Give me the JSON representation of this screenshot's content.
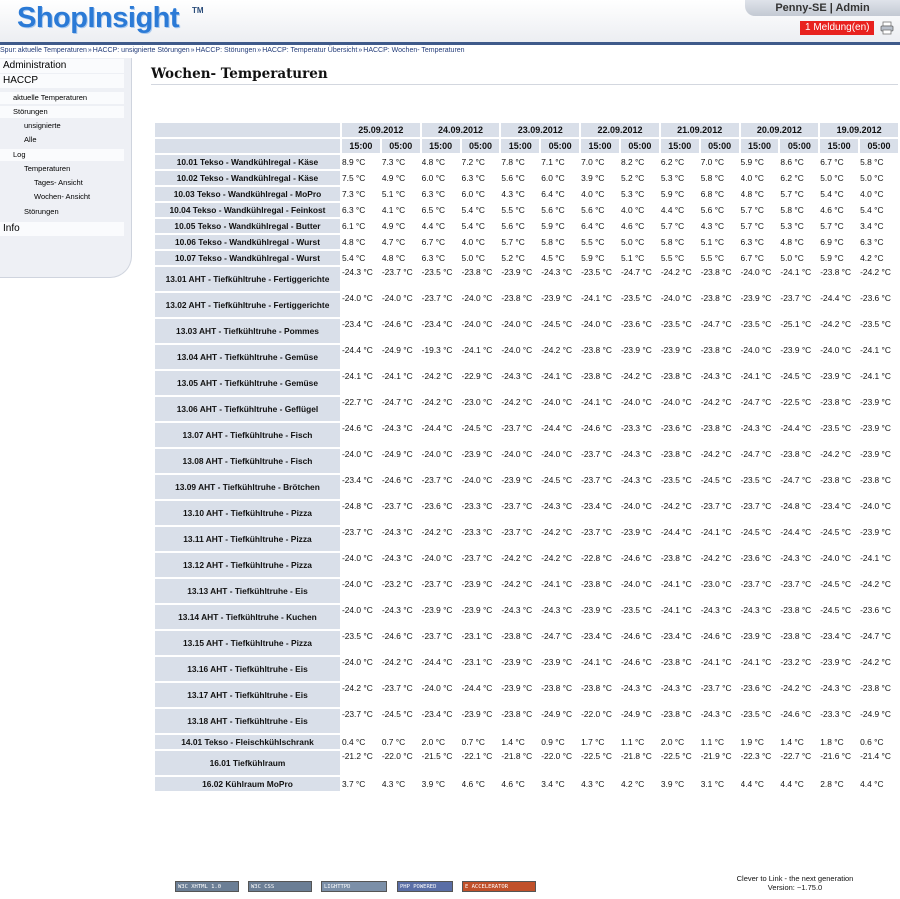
{
  "app": {
    "logo": "ShopInsight",
    "logo_tm": "TM",
    "user": "Penny-SE | Admin",
    "messages": "1 Meldung(en)",
    "print_icon": "printer-icon"
  },
  "breadcrumb": [
    "Spur:",
    "aktuelle Temperaturen",
    "»",
    "HACCP: unsignierte Störungen",
    "»",
    "HACCP: Störungen",
    "»",
    "HACCP: Temperatur Übersicht",
    "»",
    "HACCP: Wochen- Temperaturen"
  ],
  "sidebar": {
    "items": [
      {
        "label": "Administration",
        "level": 0
      },
      {
        "label": "HACCP",
        "level": 0
      },
      {
        "label": "aktuelle Temperaturen",
        "level": 1
      },
      {
        "label": "Störungen",
        "level": 1
      },
      {
        "label": "unsignierte",
        "level": 2
      },
      {
        "label": "Alle",
        "level": 2
      },
      {
        "label": "Log",
        "level": 1
      },
      {
        "label": "Temperaturen",
        "level": 2
      },
      {
        "label": "Tages- Ansicht",
        "level": 3
      },
      {
        "label": "Wochen- Ansicht",
        "level": 3
      },
      {
        "label": "Störungen",
        "level": 2
      },
      {
        "label": "Info",
        "level": 0
      }
    ]
  },
  "main": {
    "title": "Wochen- Temperaturen",
    "dates": [
      "25.09.2012",
      "24.09.2012",
      "23.09.2012",
      "22.09.2012",
      "21.09.2012",
      "20.09.2012",
      "19.09.2012"
    ],
    "times": [
      "15:00",
      "05:00",
      "15:00",
      "05:00",
      "15:00",
      "05:00",
      "15:00",
      "05:00",
      "15:00",
      "05:00",
      "15:00",
      "05:00",
      "15:00",
      "05:00"
    ],
    "rows": [
      {
        "label": "10.01 Tekso - Wandkühlregal - Käse",
        "values": [
          "8.9 °C",
          "7.3 °C",
          "4.8 °C",
          "7.2 °C",
          "7.8 °C",
          "7.1 °C",
          "7.0 °C",
          "8.2 °C",
          "6.2 °C",
          "7.0 °C",
          "5.9 °C",
          "8.6 °C",
          "6.7 °C",
          "5.8 °C"
        ]
      },
      {
        "label": "10.02 Tekso - Wandkühlregal - Käse",
        "values": [
          "7.5 °C",
          "4.9 °C",
          "6.0 °C",
          "6.3 °C",
          "5.6 °C",
          "6.0 °C",
          "3.9 °C",
          "5.2 °C",
          "5.3 °C",
          "5.8 °C",
          "4.0 °C",
          "6.2 °C",
          "5.0 °C",
          "5.0 °C"
        ]
      },
      {
        "label": "10.03 Tekso - Wandkühlregal - MoPro",
        "values": [
          "7.3 °C",
          "5.1 °C",
          "6.3 °C",
          "6.0 °C",
          "4.3 °C",
          "6.4 °C",
          "4.0 °C",
          "5.3 °C",
          "5.9 °C",
          "6.8 °C",
          "4.8 °C",
          "5.7 °C",
          "5.4 °C",
          "4.0 °C"
        ]
      },
      {
        "label": "10.04 Tekso - Wandkühlregal - Feinkost",
        "values": [
          "6.3 °C",
          "4.1 °C",
          "6.5 °C",
          "5.4 °C",
          "5.5 °C",
          "5.6 °C",
          "5.6 °C",
          "4.0 °C",
          "4.4 °C",
          "5.6 °C",
          "5.7 °C",
          "5.8 °C",
          "4.6 °C",
          "5.4 °C"
        ]
      },
      {
        "label": "10.05 Tekso - Wandkühlregal - Butter",
        "values": [
          "6.1 °C",
          "4.9 °C",
          "4.4 °C",
          "5.4 °C",
          "5.6 °C",
          "5.9 °C",
          "6.4 °C",
          "4.6 °C",
          "5.7 °C",
          "4.3 °C",
          "5.7 °C",
          "5.3 °C",
          "5.7 °C",
          "3.4 °C"
        ]
      },
      {
        "label": "10.06 Tekso - Wandkühlregal - Wurst",
        "values": [
          "4.8 °C",
          "4.7 °C",
          "6.7 °C",
          "4.0 °C",
          "5.7 °C",
          "5.8 °C",
          "5.5 °C",
          "5.0 °C",
          "5.8 °C",
          "5.1 °C",
          "6.3 °C",
          "4.8 °C",
          "6.9 °C",
          "6.3 °C"
        ]
      },
      {
        "label": "10.07 Tekso - Wandkühlregal - Wurst",
        "values": [
          "5.4 °C",
          "4.8 °C",
          "6.3 °C",
          "5.0 °C",
          "5.2 °C",
          "4.5 °C",
          "5.9 °C",
          "5.1 °C",
          "5.5 °C",
          "5.5 °C",
          "6.7 °C",
          "5.0 °C",
          "5.9 °C",
          "4.2 °C"
        ]
      },
      {
        "label": "13.01 AHT - Tiefkühltruhe - Fertiggerichte",
        "values": [
          "-24.3 °C",
          "-23.7 °C",
          "-23.5 °C",
          "-23.8 °C",
          "-23.9 °C",
          "-24.3 °C",
          "-23.5 °C",
          "-24.7 °C",
          "-24.2 °C",
          "-23.8 °C",
          "-24.0 °C",
          "-24.1 °C",
          "-23.8 °C",
          "-24.2 °C"
        ]
      },
      {
        "label": "13.02 AHT - Tiefkühltruhe - Fertiggerichte",
        "values": [
          "-24.0 °C",
          "-24.0 °C",
          "-23.7 °C",
          "-24.0 °C",
          "-23.8 °C",
          "-23.9 °C",
          "-24.1 °C",
          "-23.5 °C",
          "-24.0 °C",
          "-23.8 °C",
          "-23.9 °C",
          "-23.7 °C",
          "-24.4 °C",
          "-23.6 °C"
        ]
      },
      {
        "label": "13.03 AHT - Tiefkühltruhe - Pommes",
        "values": [
          "-23.4 °C",
          "-24.6 °C",
          "-23.4 °C",
          "-24.0 °C",
          "-24.0 °C",
          "-24.5 °C",
          "-24.0 °C",
          "-23.6 °C",
          "-23.5 °C",
          "-24.7 °C",
          "-23.5 °C",
          "-25.1 °C",
          "-24.2 °C",
          "-23.5 °C"
        ]
      },
      {
        "label": "13.04 AHT - Tiefkühltruhe - Gemüse",
        "values": [
          "-24.4 °C",
          "-24.9 °C",
          "-19.3 °C",
          "-24.1 °C",
          "-24.0 °C",
          "-24.2 °C",
          "-23.8 °C",
          "-23.9 °C",
          "-23.9 °C",
          "-23.8 °C",
          "-24.0 °C",
          "-23.9 °C",
          "-24.0 °C",
          "-24.1 °C"
        ]
      },
      {
        "label": "13.05 AHT - Tiefkühltruhe - Gemüse",
        "values": [
          "-24.1 °C",
          "-24.1 °C",
          "-24.2 °C",
          "-22.9 °C",
          "-24.3 °C",
          "-24.1 °C",
          "-23.8 °C",
          "-24.2 °C",
          "-23.8 °C",
          "-24.3 °C",
          "-24.1 °C",
          "-24.5 °C",
          "-23.9 °C",
          "-24.1 °C"
        ]
      },
      {
        "label": "13.06 AHT - Tiefkühltruhe - Geflügel",
        "values": [
          "-22.7 °C",
          "-24.7 °C",
          "-24.2 °C",
          "-23.0 °C",
          "-24.2 °C",
          "-24.0 °C",
          "-24.1 °C",
          "-24.0 °C",
          "-24.0 °C",
          "-24.2 °C",
          "-24.7 °C",
          "-22.5 °C",
          "-23.8 °C",
          "-23.9 °C"
        ]
      },
      {
        "label": "13.07 AHT - Tiefkühltruhe - Fisch",
        "values": [
          "-24.6 °C",
          "-24.3 °C",
          "-24.4 °C",
          "-24.5 °C",
          "-23.7 °C",
          "-24.4 °C",
          "-24.6 °C",
          "-23.3 °C",
          "-23.6 °C",
          "-23.8 °C",
          "-24.3 °C",
          "-24.4 °C",
          "-23.5 °C",
          "-23.9 °C"
        ]
      },
      {
        "label": "13.08 AHT - Tiefkühltruhe - Fisch",
        "values": [
          "-24.0 °C",
          "-24.9 °C",
          "-24.0 °C",
          "-23.9 °C",
          "-24.0 °C",
          "-24.0 °C",
          "-23.7 °C",
          "-24.3 °C",
          "-23.8 °C",
          "-24.2 °C",
          "-24.7 °C",
          "-23.8 °C",
          "-24.2 °C",
          "-23.9 °C"
        ]
      },
      {
        "label": "13.09 AHT - Tiefkühltruhe - Brötchen",
        "values": [
          "-23.4 °C",
          "-24.6 °C",
          "-23.7 °C",
          "-24.0 °C",
          "-23.9 °C",
          "-24.5 °C",
          "-23.7 °C",
          "-24.3 °C",
          "-23.5 °C",
          "-24.5 °C",
          "-23.5 °C",
          "-24.7 °C",
          "-23.8 °C",
          "-23.8 °C"
        ]
      },
      {
        "label": "13.10 AHT - Tiefkühltruhe - Pizza",
        "values": [
          "-24.8 °C",
          "-23.7 °C",
          "-23.6 °C",
          "-23.3 °C",
          "-23.7 °C",
          "-24.3 °C",
          "-23.4 °C",
          "-24.0 °C",
          "-24.2 °C",
          "-23.7 °C",
          "-23.7 °C",
          "-24.8 °C",
          "-23.4 °C",
          "-24.0 °C"
        ]
      },
      {
        "label": "13.11 AHT - Tiefkühltruhe - Pizza",
        "values": [
          "-23.7 °C",
          "-24.3 °C",
          "-24.2 °C",
          "-23.3 °C",
          "-23.7 °C",
          "-24.2 °C",
          "-23.7 °C",
          "-23.9 °C",
          "-24.4 °C",
          "-24.1 °C",
          "-24.5 °C",
          "-24.4 °C",
          "-24.5 °C",
          "-23.9 °C"
        ]
      },
      {
        "label": "13.12 AHT - Tiefkühltruhe - Pizza",
        "values": [
          "-24.0 °C",
          "-24.3 °C",
          "-24.0 °C",
          "-23.7 °C",
          "-24.2 °C",
          "-24.2 °C",
          "-22.8 °C",
          "-24.6 °C",
          "-23.8 °C",
          "-24.2 °C",
          "-23.6 °C",
          "-24.3 °C",
          "-24.0 °C",
          "-24.1 °C"
        ]
      },
      {
        "label": "13.13 AHT - Tiefkühltruhe - Eis",
        "values": [
          "-24.0 °C",
          "-23.2 °C",
          "-23.7 °C",
          "-23.9 °C",
          "-24.2 °C",
          "-24.1 °C",
          "-23.8 °C",
          "-24.0 °C",
          "-24.1 °C",
          "-23.0 °C",
          "-23.7 °C",
          "-23.7 °C",
          "-24.5 °C",
          "-24.2 °C"
        ]
      },
      {
        "label": "13.14 AHT - Tiefkühltruhe - Kuchen",
        "values": [
          "-24.0 °C",
          "-24.3 °C",
          "-23.9 °C",
          "-23.9 °C",
          "-24.3 °C",
          "-24.3 °C",
          "-23.9 °C",
          "-23.5 °C",
          "-24.1 °C",
          "-24.3 °C",
          "-24.3 °C",
          "-23.8 °C",
          "-24.5 °C",
          "-23.6 °C"
        ]
      },
      {
        "label": "13.15 AHT - Tiefkühltruhe - Pizza",
        "values": [
          "-23.5 °C",
          "-24.6 °C",
          "-23.7 °C",
          "-23.1 °C",
          "-23.8 °C",
          "-24.7 °C",
          "-23.4 °C",
          "-24.6 °C",
          "-23.4 °C",
          "-24.6 °C",
          "-23.9 °C",
          "-23.8 °C",
          "-23.4 °C",
          "-24.7 °C"
        ]
      },
      {
        "label": "13.16 AHT - Tiefkühltruhe - Eis",
        "values": [
          "-24.0 °C",
          "-24.2 °C",
          "-24.4 °C",
          "-23.1 °C",
          "-23.9 °C",
          "-23.9 °C",
          "-24.1 °C",
          "-24.6 °C",
          "-23.8 °C",
          "-24.1 °C",
          "-24.1 °C",
          "-23.2 °C",
          "-23.9 °C",
          "-24.2 °C"
        ]
      },
      {
        "label": "13.17 AHT - Tiefkühltruhe - Eis",
        "values": [
          "-24.2 °C",
          "-23.7 °C",
          "-24.0 °C",
          "-24.4 °C",
          "-23.9 °C",
          "-23.8 °C",
          "-23.8 °C",
          "-24.3 °C",
          "-24.3 °C",
          "-23.7 °C",
          "-23.6 °C",
          "-24.2 °C",
          "-24.3 °C",
          "-23.8 °C"
        ]
      },
      {
        "label": "13.18 AHT - Tiefkühltruhe - Eis",
        "values": [
          "-23.7 °C",
          "-24.5 °C",
          "-23.4 °C",
          "-23.9 °C",
          "-23.8 °C",
          "-24.9 °C",
          "-22.0 °C",
          "-24.9 °C",
          "-23.8 °C",
          "-24.3 °C",
          "-23.5 °C",
          "-24.6 °C",
          "-23.3 °C",
          "-24.9 °C"
        ]
      },
      {
        "label": "14.01 Tekso - Fleischkühlschrank",
        "values": [
          "0.4 °C",
          "0.7 °C",
          "2.0 °C",
          "0.7 °C",
          "1.4 °C",
          "0.9 °C",
          "1.7 °C",
          "1.1 °C",
          "2.0 °C",
          "1.1 °C",
          "1.9 °C",
          "1.4 °C",
          "1.8 °C",
          "0.6 °C"
        ]
      },
      {
        "label": "16.01 Tiefkühlraum",
        "values": [
          "-21.2 °C",
          "-22.0 °C",
          "-21.5 °C",
          "-22.1 °C",
          "-21.8 °C",
          "-22.0 °C",
          "-22.5 °C",
          "-21.8 °C",
          "-22.5 °C",
          "-21.9 °C",
          "-22.3 °C",
          "-22.7 °C",
          "-21.6 °C",
          "-21.4 °C"
        ]
      },
      {
        "label": "16.02 Kühlraum MoPro",
        "values": [
          "3.7 °C",
          "4.3 °C",
          "3.9 °C",
          "4.6 °C",
          "4.6 °C",
          "3.4 °C",
          "4.3 °C",
          "4.2 °C",
          "3.9 °C",
          "3.1 °C",
          "4.4 °C",
          "4.4 °C",
          "2.8 °C",
          "4.4 °C"
        ]
      }
    ]
  },
  "footer": {
    "badges": [
      {
        "text": "W3C XHTML 1.0",
        "color": "#6b7e95"
      },
      {
        "text": "W3C CSS",
        "color": "#6b7e95"
      },
      {
        "text": "LIGHTTPD",
        "color": "#7b8fa8"
      },
      {
        "text": "PHP POWERED",
        "color": "#5a6ea6"
      },
      {
        "text": "E ACCELERATOR",
        "color": "#c0502a"
      }
    ],
    "line1": "Clever to Link - the next generation",
    "line2": "Version: ~1.75.0"
  },
  "colors": {
    "accent": "#2b7ad6",
    "header_bar": "#3f5a8a",
    "alert": "#e8221f",
    "cell_bg": "#d9dfe9"
  }
}
